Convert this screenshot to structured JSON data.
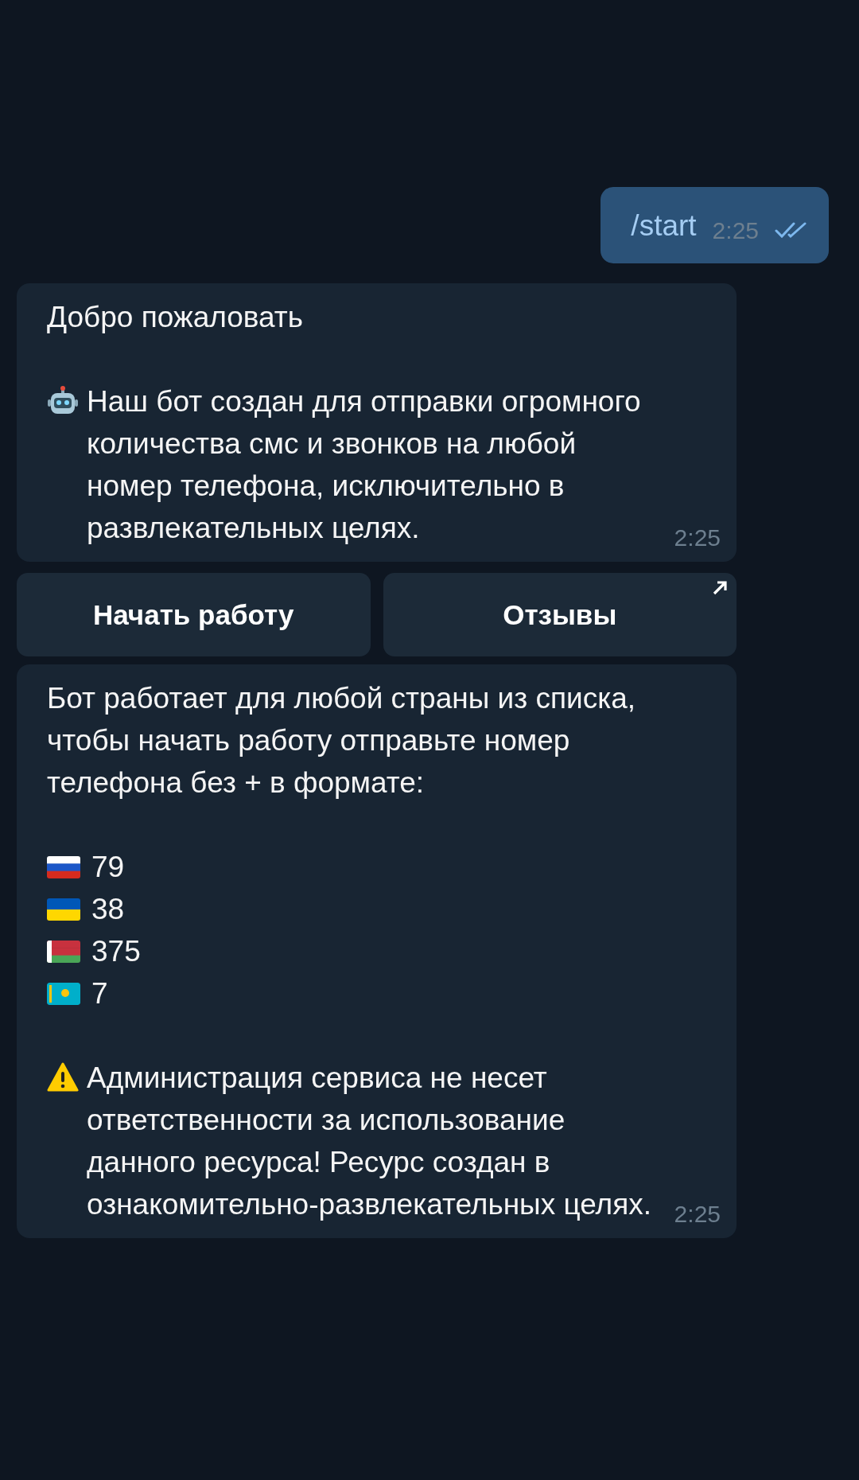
{
  "outgoing": {
    "text": "/start",
    "time": "2:25",
    "read": true
  },
  "welcome": {
    "title": "Добро пожаловать",
    "body": "Наш бот создан для отправки огромного количества смс и звонков на любой номер телефона, исключительно в развлекательных целях.",
    "time": "2:25"
  },
  "buttons": [
    {
      "label": "Начать работу",
      "external": false
    },
    {
      "label": "Отзывы",
      "external": true
    }
  ],
  "info": {
    "intro": "Бот работает для любой страны из списка, чтобы начать работу отправьте номер телефона без + в формате:",
    "countries": [
      {
        "kind": "ru",
        "code": "79"
      },
      {
        "kind": "ua",
        "code": "38"
      },
      {
        "kind": "by",
        "code": "375"
      },
      {
        "kind": "kz",
        "code": "7"
      }
    ],
    "warning": "Администрация сервиса не несет ответственности за использование данного ресурса! Ресурс создан в ознакомительно-развлекательных целях.",
    "time": "2:25"
  }
}
